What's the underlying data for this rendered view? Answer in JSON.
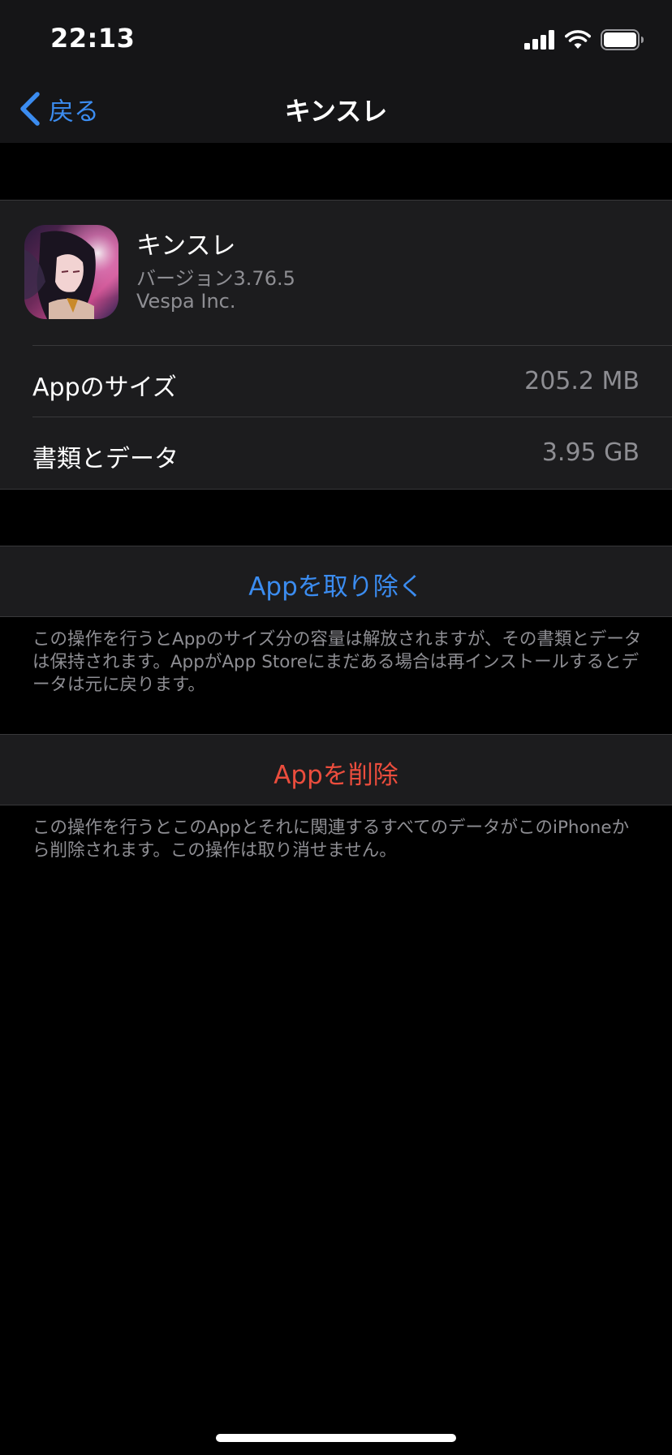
{
  "status_bar": {
    "time": "22:13"
  },
  "nav": {
    "back_label": "戻る",
    "title": "キンスレ"
  },
  "app": {
    "name": "キンスレ",
    "version": "バージョン3.76.5",
    "developer": "Vespa Inc."
  },
  "storage": {
    "rows": [
      {
        "label": "Appのサイズ",
        "value": "205.2 MB"
      },
      {
        "label": "書類とデータ",
        "value": "3.95 GB"
      }
    ]
  },
  "actions": {
    "offload_label": "Appを取り除く",
    "offload_note": "この操作を行うとAppのサイズ分の容量は解放されますが、その書類とデータは保持されます。AppがApp Storeにまだある場合は再インストールするとデータは元に戻ります。",
    "delete_label": "Appを削除",
    "delete_note": "この操作を行うとこのAppとそれに関連するすべてのデータがこのiPhoneから削除されます。この操作は取り消せません。"
  },
  "colors": {
    "accent_blue": "#3b8cf0",
    "destructive_red": "#eb4d3d",
    "secondary_text": "#8e8e93",
    "group_background": "#1c1c1e"
  },
  "icons": {
    "back": "chevron-left-icon",
    "signal": "cellular-signal-icon",
    "wifi": "wifi-icon",
    "battery": "battery-icon"
  }
}
